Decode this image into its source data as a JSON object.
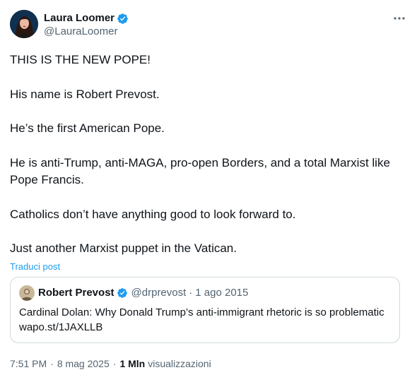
{
  "author": {
    "display_name": "Laura Loomer",
    "handle": "@LauraLoomer",
    "verified_color": "#1d9bf0"
  },
  "tweet": {
    "paragraphs": [
      "THIS IS THE NEW POPE!",
      "His name is Robert Prevost.",
      "He’s the first American Pope.",
      "He is anti-Trump, anti-MAGA, pro-open Borders, and a total Marxist like Pope Francis.",
      "Catholics don’t have anything good to look forward to.",
      "Just another Marxist puppet in the Vatican."
    ],
    "translate_label": "Traduci post"
  },
  "quote": {
    "display_name": "Robert Prevost",
    "handle": "@drprevost",
    "separator": "·",
    "date": "1 ago 2015",
    "text_line1": "Cardinal Dolan: Why Donald Trump’s anti-immigrant rhetoric is so problematic",
    "text_line2": "wapo.st/1JAXLLB"
  },
  "meta": {
    "time": "7:51 PM",
    "separator": "·",
    "date": "8 mag 2025",
    "views_count": "1 Mln",
    "views_label": "visualizzazioni"
  },
  "icons": {
    "more": "more-horizontal-icon",
    "verified": "verified-badge-icon"
  },
  "colors": {
    "accent": "#1d9bf0",
    "text": "#0f1419",
    "secondary": "#536471",
    "border": "#cfd9de"
  }
}
